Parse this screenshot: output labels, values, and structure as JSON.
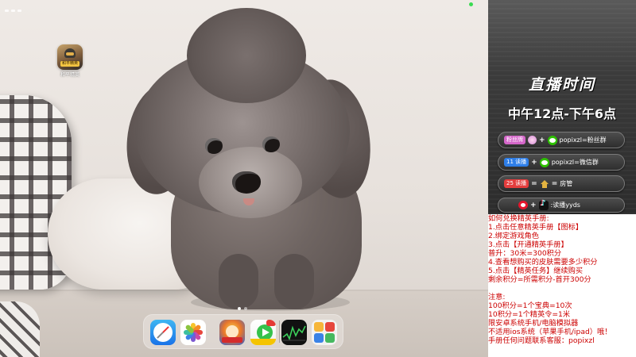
{
  "desktop": {
    "apps": [
      {
        "name": "和平精英",
        "badge_text": "和平精英"
      }
    ],
    "dock": {
      "apps": [
        "Safari",
        "Photos",
        "Game",
        "Video",
        "Stocks",
        "App Library"
      ]
    },
    "page_dots": 2
  },
  "panel": {
    "title": "直播时间",
    "hours": "中午12点-下午6点",
    "rows": [
      {
        "tag": "粉丝牌",
        "plus": "+",
        "text": "popixzl=粉丝群"
      },
      {
        "tag": "11 读播",
        "plus": "+",
        "text": "popixzl=微信群"
      },
      {
        "tag": "25 读播",
        "plus": "=",
        "text": "房管"
      },
      {
        "tag": "",
        "plus": "+",
        "text": ":读播yyds"
      }
    ],
    "tag_colors": [
      "#d466c9",
      "#2e7ee8",
      "#e43d3d",
      "#e6162d"
    ]
  },
  "info": {
    "lines": [
      "如何兑换精英手册:",
      "1.点击任意精英手册【图标】",
      "2.绑定游戏角色",
      "3.点击【开通精英手册】",
      "    普升：30米=300积分",
      "4.查看想购买的皮肤需要多少积分",
      "5.点击【精英任务】继续购买",
      "剩余积分=所需积分-首开300分",
      "",
      "注意:",
      "100积分=1个宝典=10次",
      "10积分=1个精英令=1米",
      "限安卓系统手机/电脑模拟器",
      "不适用ios系统（苹果手机/ipad）哦！",
      "手册任何问题联系客服：popixzl"
    ]
  }
}
